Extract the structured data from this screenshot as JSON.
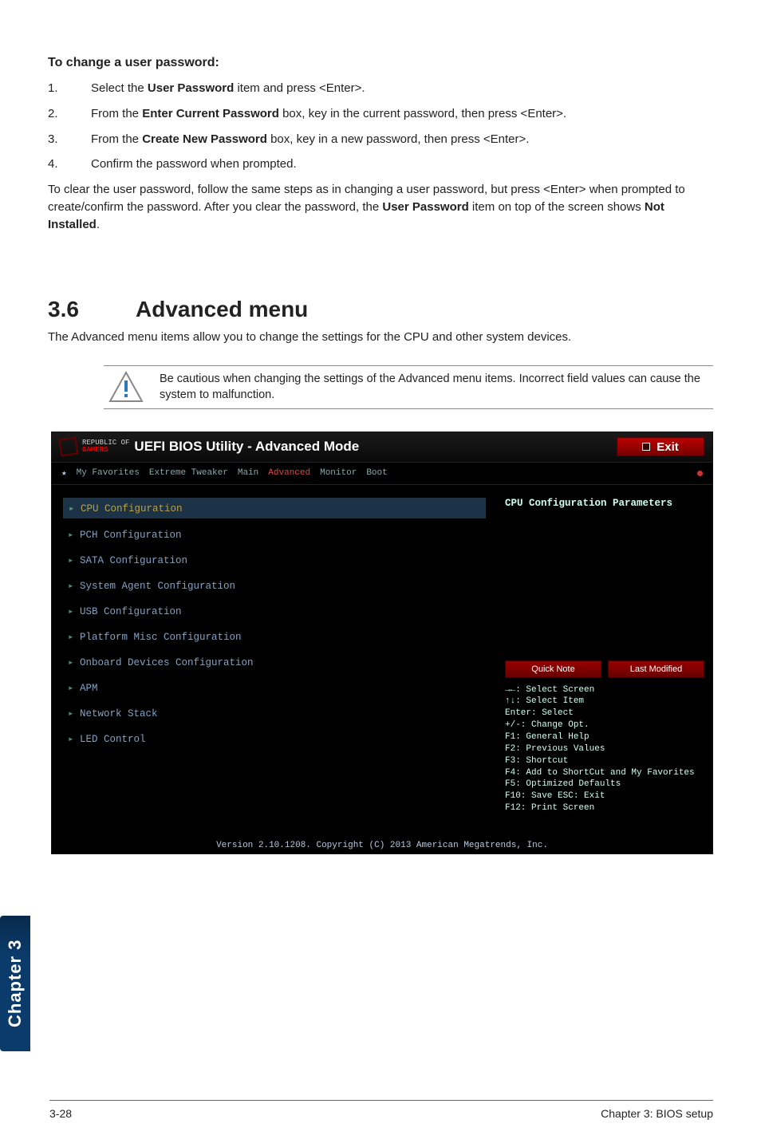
{
  "doc": {
    "chapter_tab": "Chapter 3",
    "section_heading": "To change a user password:",
    "steps": [
      {
        "num": "1.",
        "before": "Select the ",
        "bold": "User Password",
        "after": " item and press <Enter>."
      },
      {
        "num": "2.",
        "before": "From the ",
        "bold": "Enter Current Password",
        "after": " box, key in the current password, then press <Enter>."
      },
      {
        "num": "3.",
        "before": "From the ",
        "bold": "Create New Password",
        "after": " box, key in a new password, then press <Enter>."
      },
      {
        "num": "4.",
        "before": "Confirm the password when prompted.",
        "bold": "",
        "after": ""
      }
    ],
    "aftertext": {
      "p1": "To clear the user password, follow the same steps as in changing a user password, but press <Enter> when prompted to create/confirm the password. After you clear the password, the ",
      "b1": "User Password",
      "p2": " item on top of the screen shows ",
      "b2": "Not Installed",
      "p3": "."
    },
    "heading_num": "3.6",
    "heading_title": "Advanced menu",
    "lead": "The Advanced menu items allow you to change the settings for the CPU and other system devices.",
    "note": "Be cautious when changing the settings of the Advanced menu items. Incorrect field values can cause the system to malfunction.",
    "footer_left": "3-28",
    "footer_right": "Chapter 3: BIOS setup"
  },
  "bios": {
    "brand_line1": "REPUBLIC OF",
    "brand_line2": "GAMERS",
    "title": "UEFI BIOS Utility - Advanced Mode",
    "exit": "Exit",
    "tabs": {
      "fav": "My Favorites",
      "tweaker": "Extreme Tweaker",
      "main": "Main",
      "advanced": "Advanced",
      "monitor": "Monitor",
      "boot": "Boot"
    },
    "left_items": [
      {
        "label": "CPU Configuration",
        "selected": true
      },
      {
        "label": "PCH Configuration",
        "selected": false
      },
      {
        "label": "SATA Configuration",
        "selected": false
      },
      {
        "label": "System Agent Configuration",
        "selected": false
      },
      {
        "label": "USB Configuration",
        "selected": false
      },
      {
        "label": "Platform Misc Configuration",
        "selected": false
      },
      {
        "label": "Onboard Devices Configuration",
        "selected": false
      },
      {
        "label": "APM",
        "selected": false
      },
      {
        "label": "Network Stack",
        "selected": false
      },
      {
        "label": "LED Control",
        "selected": false
      }
    ],
    "right_title": "CPU Configuration Parameters",
    "buttons": {
      "quick": "Quick Note",
      "last": "Last Modified"
    },
    "help": [
      "→←: Select Screen",
      "↑↓: Select Item",
      "Enter: Select",
      "+/-: Change Opt.",
      "F1: General Help",
      "F2: Previous Values",
      "F3: Shortcut",
      "F4: Add to ShortCut and My Favorites",
      "F5: Optimized Defaults",
      "F10: Save  ESC: Exit",
      "F12: Print Screen"
    ],
    "footer": "Version 2.10.1208. Copyright (C) 2013 American Megatrends, Inc."
  }
}
